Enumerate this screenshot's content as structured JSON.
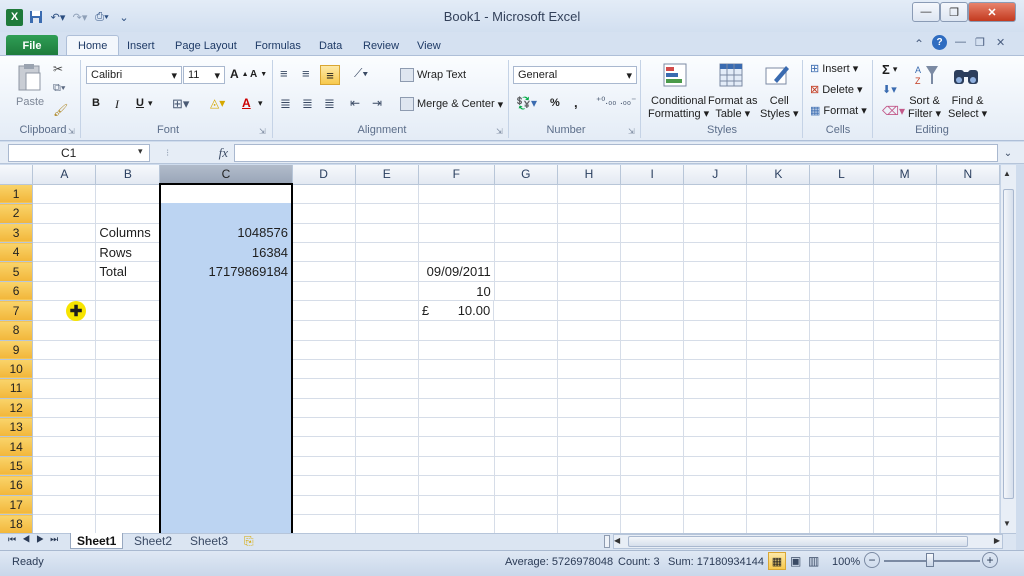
{
  "window": {
    "title": "Book1 - Microsoft Excel",
    "min": "—",
    "max": "❐",
    "close": "✕"
  },
  "tabs": [
    "File",
    "Home",
    "Insert",
    "Page Layout",
    "Formulas",
    "Data",
    "Review",
    "View"
  ],
  "ribbon": {
    "clipboard": {
      "paste": "Paste",
      "label": "Clipboard"
    },
    "font": {
      "name": "Calibri",
      "size": "11",
      "bold": "B",
      "italic": "I",
      "underline": "U",
      "grow": "A",
      "shrink": "A",
      "fontcolor": "A",
      "label": "Font"
    },
    "alignment": {
      "wrap": "Wrap Text",
      "merge": "Merge & Center",
      "label": "Alignment"
    },
    "number": {
      "format": "General",
      "percent": "%",
      "comma": ",",
      "label": "Number"
    },
    "styles": {
      "cond1": "Conditional",
      "cond2": "Formatting",
      "fmt1": "Format as",
      "fmt2": "Table",
      "cell1": "Cell",
      "cell2": "Styles",
      "label": "Styles"
    },
    "cells": {
      "insert": "Insert",
      "delete": "Delete",
      "format": "Format",
      "label": "Cells"
    },
    "editing": {
      "sigma": "Σ",
      "sort1": "Sort &",
      "sort2": "Filter",
      "find1": "Find &",
      "find2": "Select",
      "label": "Editing"
    }
  },
  "formula": {
    "name_box": "C1",
    "fx": "fx",
    "value": ""
  },
  "columns": [
    "A",
    "B",
    "C",
    "D",
    "E",
    "F",
    "G",
    "H",
    "I",
    "J",
    "K",
    "L",
    "M",
    "N"
  ],
  "rows": [
    {
      "n": "1",
      "A": "",
      "B": "",
      "C": "",
      "F": ""
    },
    {
      "n": "2",
      "A": "",
      "B": "",
      "C": "",
      "F": ""
    },
    {
      "n": "3",
      "A": "",
      "B": "Columns",
      "C": "1048576",
      "F": ""
    },
    {
      "n": "4",
      "A": "",
      "B": "Rows",
      "C": "16384",
      "F": ""
    },
    {
      "n": "5",
      "A": "",
      "B": "Total",
      "C": "17179869184",
      "F": "09/09/2011"
    },
    {
      "n": "6",
      "A": "",
      "B": "",
      "C": "",
      "F": "10"
    },
    {
      "n": "7",
      "A": "",
      "B": "",
      "C": "",
      "F_cur": "£",
      "F": "10.00"
    },
    {
      "n": "8"
    },
    {
      "n": "9"
    },
    {
      "n": "10"
    },
    {
      "n": "11"
    },
    {
      "n": "12"
    },
    {
      "n": "13"
    },
    {
      "n": "14"
    },
    {
      "n": "15"
    },
    {
      "n": "16"
    },
    {
      "n": "17"
    },
    {
      "n": "18"
    }
  ],
  "sheets": [
    "Sheet1",
    "Sheet2",
    "Sheet3"
  ],
  "status": {
    "mode": "Ready",
    "average": "Average: 5726978048",
    "count": "Count: 3",
    "sum": "Sum: 17180934144",
    "zoom": "100%"
  },
  "colors": {
    "selection": "#bcd4f2",
    "accent": "#1d7a3b",
    "row_header_sel": "#f2b63a"
  }
}
